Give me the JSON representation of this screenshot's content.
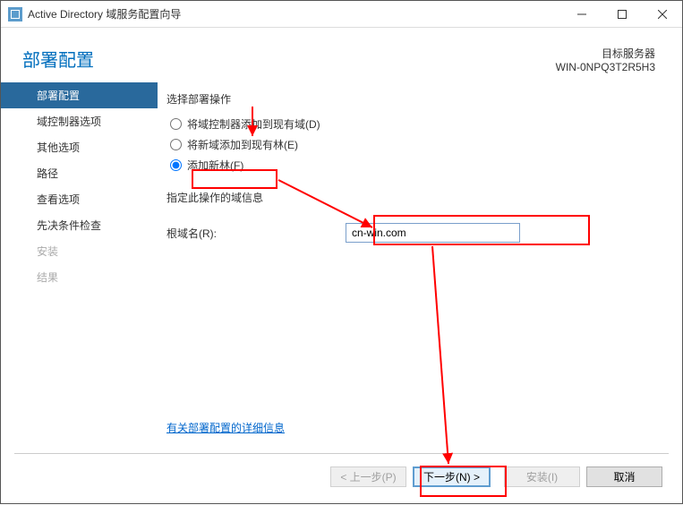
{
  "titlebar": {
    "title": "Active Directory 域服务配置向导"
  },
  "header": {
    "page_title": "部署配置",
    "target_label": "目标服务器",
    "target_value": "WIN-0NPQ3T2R5H3"
  },
  "sidebar": {
    "items": [
      {
        "label": "部署配置",
        "state": "active"
      },
      {
        "label": "域控制器选项",
        "state": "normal"
      },
      {
        "label": "其他选项",
        "state": "normal"
      },
      {
        "label": "路径",
        "state": "normal"
      },
      {
        "label": "查看选项",
        "state": "normal"
      },
      {
        "label": "先决条件检查",
        "state": "normal"
      },
      {
        "label": "安装",
        "state": "disabled"
      },
      {
        "label": "结果",
        "state": "disabled"
      }
    ]
  },
  "content": {
    "select_op_label": "选择部署操作",
    "radios": [
      {
        "label": "将域控制器添加到现有域(D)",
        "checked": false
      },
      {
        "label": "将新域添加到现有林(E)",
        "checked": false
      },
      {
        "label": "添加新林(F)",
        "checked": true
      }
    ],
    "domain_info_label": "指定此操作的域信息",
    "root_domain_label": "根域名(R):",
    "root_domain_value": "cn-win.com",
    "more_info_link": "有关部署配置的详细信息"
  },
  "footer": {
    "prev": "< 上一步(P)",
    "next": "下一步(N) >",
    "install": "安装(I)",
    "cancel": "取消"
  }
}
